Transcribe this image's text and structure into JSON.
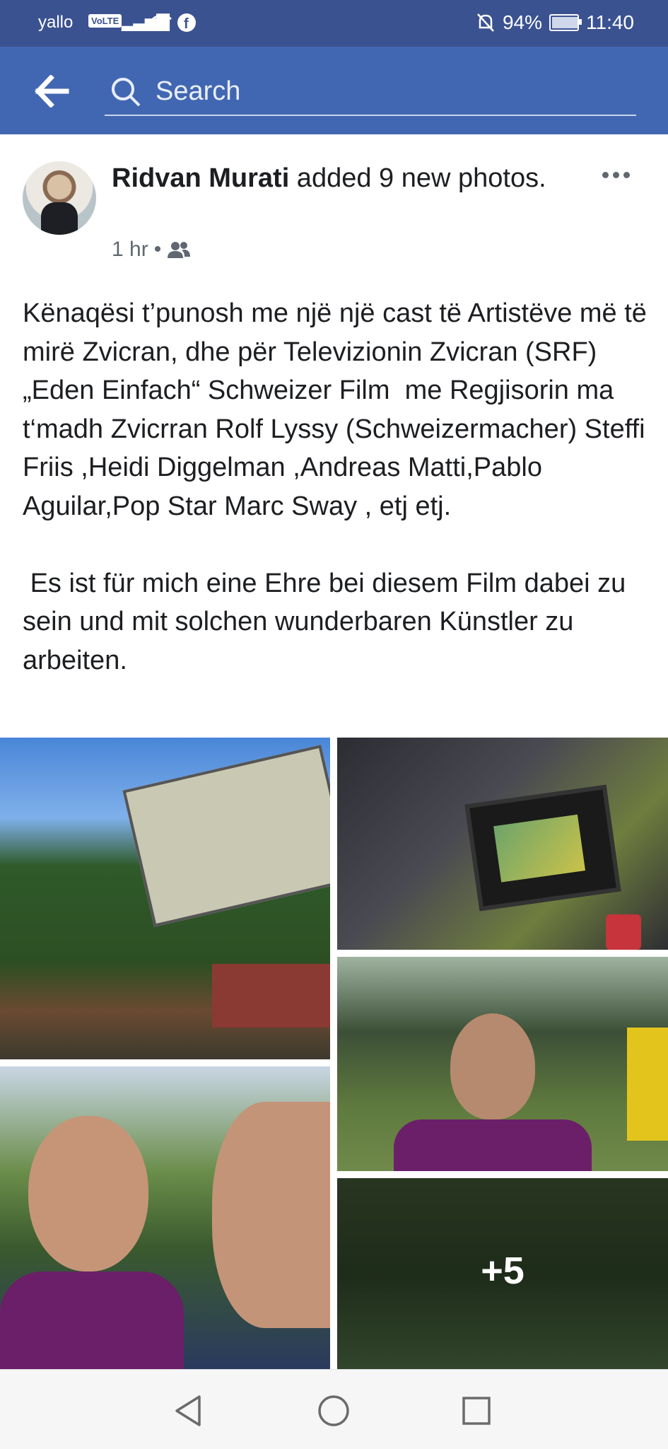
{
  "status_bar": {
    "carrier": "yallo",
    "volte": "VoLTE",
    "battery": "94%",
    "battery_level": 0.94,
    "time": "11:40"
  },
  "header": {
    "search_placeholder": "Search"
  },
  "post": {
    "author": "Ridvan Murati",
    "action": " added 9 new photos.",
    "time": "1 hr",
    "separator": " • ",
    "audience_icon": "friends-icon",
    "text_albanian": "Kënaqësi t’punosh me një një cast të Artistëve më të mirë Zvicran, dhe për Televizionin Zvicran (SRF) „Eden Einfach“ Schweizer Film  me Regjisorin ma t‘madh Zvicrran Rolf Lyssy (Schweizermacher) Steffi Friis ,Heidi Diggelman ,Andreas Matti,Pablo Aguilar,Pop Star Marc Sway , etj etj.",
    "text_german": " Es ist für mich eine Ehre bei diesem Film dabei zu sein und mit solchen wunderbaren Künstler zu arbeiten.",
    "more_photos_count": "+5"
  },
  "colors": {
    "status_bar": "#3b5291",
    "header": "#4267b2",
    "text": "#1c1e21",
    "meta": "#606770"
  },
  "nav": {
    "back_icon": "triangle-back-icon",
    "home_icon": "circle-home-icon",
    "recent_icon": "square-recent-icon"
  }
}
